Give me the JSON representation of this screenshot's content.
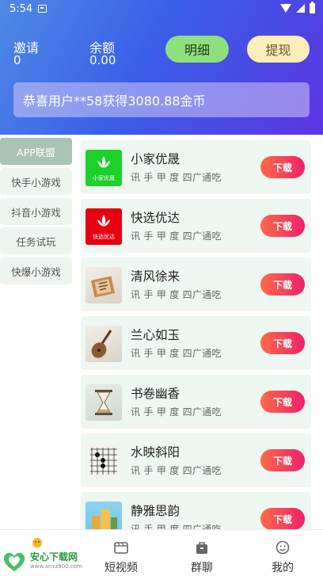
{
  "status": {
    "time": "5:54"
  },
  "header": {
    "invite_label": "邀请",
    "invite_value": "0",
    "balance_label": "余额",
    "balance_value": "0.00",
    "detail_button": "明细",
    "withdraw_button": "提现",
    "banner_text": "恭喜用户**58获得3080.88金币"
  },
  "sidebar": {
    "items": [
      {
        "label": "APP联盟",
        "active": true
      },
      {
        "label": "快手小游戏"
      },
      {
        "label": "抖音小游戏"
      },
      {
        "label": "任务试玩"
      },
      {
        "label": "快爆小游戏"
      }
    ]
  },
  "apps": [
    {
      "name": "小家优晟",
      "tags": "讯 手 甲 度 四广通吃",
      "download": "下载",
      "icon": "lotus-logo-green-icon",
      "icon_caption": "小家优晟"
    },
    {
      "name": "快选优达",
      "tags": "讯 手 甲 度 四广通吃",
      "download": "下载",
      "icon": "lotus-logo-red-icon",
      "icon_caption": "快选优达"
    },
    {
      "name": "清风徐来",
      "tags": "讯 手 甲 度 四广通吃",
      "download": "下载",
      "icon": "scroll-art-icon"
    },
    {
      "name": "兰心如玉",
      "tags": "讯 手 甲 度 四广通吃",
      "download": "下载",
      "icon": "pipa-instrument-icon"
    },
    {
      "name": "书卷幽香",
      "tags": "讯 手 甲 度 四广通吃",
      "download": "下载",
      "icon": "hourglass-icon"
    },
    {
      "name": "水映斜阳",
      "tags": "讯 手 甲 度 四广通吃",
      "download": "下载",
      "icon": "go-board-icon"
    },
    {
      "name": "静雅思韵",
      "tags": "讯 手 甲 度 四广通吃",
      "download": "下载",
      "icon": "buildings-icon"
    }
  ],
  "tabbar": {
    "tabs": [
      {
        "label": "",
        "icon": "home-icon"
      },
      {
        "label": "短视频",
        "icon": "video-icon"
      },
      {
        "label": "群聊",
        "icon": "bag-icon"
      },
      {
        "label": "我的",
        "icon": "smiley-icon"
      }
    ]
  },
  "watermark": {
    "brand": "安心下载网",
    "url": "www.anxz800.com"
  },
  "colors": {
    "header_start": "#4f8ae6",
    "header_end": "#5b35e2",
    "download_start": "#ff6a4a",
    "download_end": "#f0206a",
    "card_bg": "#eef7f1"
  }
}
